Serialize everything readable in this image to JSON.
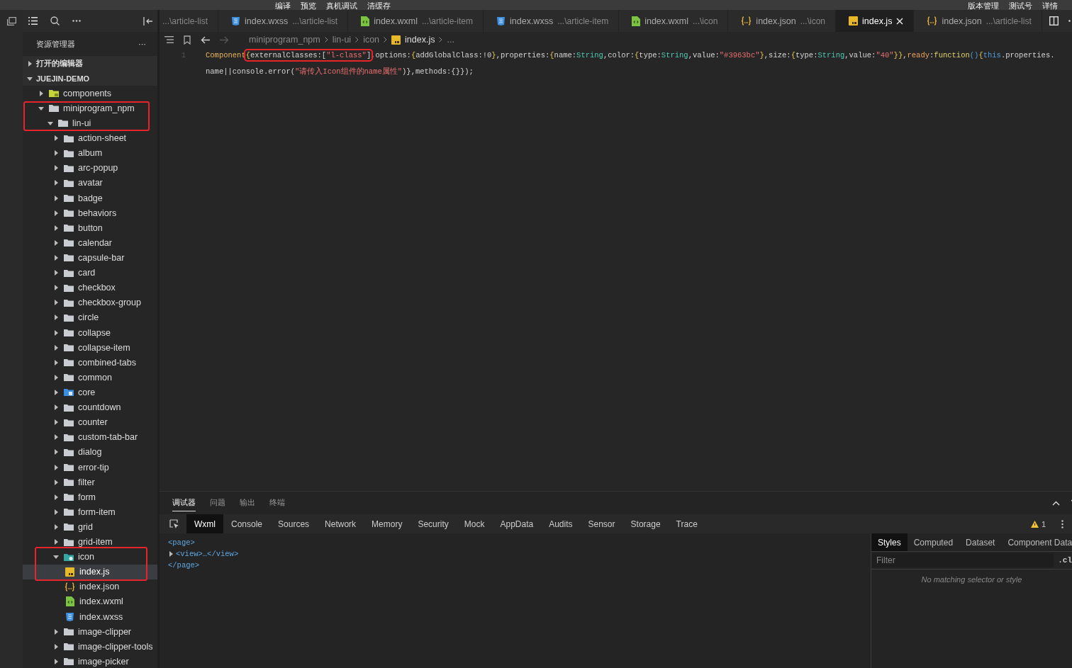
{
  "menubar": {
    "left": [
      "编译",
      "预览",
      "真机调试",
      "清缓存"
    ],
    "right": [
      "版本管理",
      "测试号",
      "详情"
    ]
  },
  "tabs": [
    {
      "path": "...\\article-list",
      "kind": "none",
      "selected": false
    },
    {
      "name": "index.wxss",
      "path": "...\\article-list",
      "kind": "wxss",
      "selected": false
    },
    {
      "name": "index.wxml",
      "path": "...\\article-item",
      "kind": "wxml",
      "selected": false
    },
    {
      "name": "index.wxss",
      "path": "...\\article-item",
      "kind": "wxss",
      "selected": false
    },
    {
      "name": "index.wxml",
      "path": "...\\icon",
      "kind": "wxml",
      "selected": false
    },
    {
      "name": "index.json",
      "path": "...\\icon",
      "kind": "json",
      "selected": false
    },
    {
      "name": "index.js",
      "kind": "js",
      "selected": true
    },
    {
      "name": "index.json",
      "path": "...\\article-list",
      "kind": "json",
      "selected": false
    }
  ],
  "explorer": {
    "title": "资源管理器",
    "more": "···",
    "sections": [
      {
        "label": "打开的编辑器",
        "expanded": false
      },
      {
        "label": "JUEJIN-DEMO",
        "expanded": true
      }
    ],
    "tree": [
      {
        "label": "components",
        "kind": "component-folder",
        "expanded": false,
        "selected": false
      },
      {
        "label": "miniprogram_npm",
        "kind": "folder",
        "expanded": true,
        "selected": false,
        "children": [
          {
            "label": "lin-ui",
            "kind": "folder",
            "expanded": true,
            "selected": false,
            "children": [
              {
                "label": "action-sheet",
                "kind": "folder",
                "expanded": false,
                "selected": false
              },
              {
                "label": "album",
                "kind": "folder",
                "expanded": false,
                "selected": false
              },
              {
                "label": "arc-popup",
                "kind": "folder",
                "expanded": false,
                "selected": false
              },
              {
                "label": "avatar",
                "kind": "folder",
                "expanded": false,
                "selected": false
              },
              {
                "label": "badge",
                "kind": "folder",
                "expanded": false,
                "selected": false
              },
              {
                "label": "behaviors",
                "kind": "folder",
                "expanded": false,
                "selected": false
              },
              {
                "label": "button",
                "kind": "folder",
                "expanded": false,
                "selected": false
              },
              {
                "label": "calendar",
                "kind": "folder",
                "expanded": false,
                "selected": false
              },
              {
                "label": "capsule-bar",
                "kind": "folder",
                "expanded": false,
                "selected": false
              },
              {
                "label": "card",
                "kind": "folder",
                "expanded": false,
                "selected": false
              },
              {
                "label": "checkbox",
                "kind": "folder",
                "expanded": false,
                "selected": false
              },
              {
                "label": "checkbox-group",
                "kind": "folder",
                "expanded": false,
                "selected": false
              },
              {
                "label": "circle",
                "kind": "folder",
                "expanded": false,
                "selected": false
              },
              {
                "label": "collapse",
                "kind": "folder",
                "expanded": false,
                "selected": false
              },
              {
                "label": "collapse-item",
                "kind": "folder",
                "expanded": false,
                "selected": false
              },
              {
                "label": "combined-tabs",
                "kind": "folder",
                "expanded": false,
                "selected": false
              },
              {
                "label": "common",
                "kind": "folder",
                "expanded": false,
                "selected": false
              },
              {
                "label": "core",
                "kind": "core-folder",
                "expanded": false,
                "selected": false
              },
              {
                "label": "countdown",
                "kind": "folder",
                "expanded": false,
                "selected": false
              },
              {
                "label": "counter",
                "kind": "folder",
                "expanded": false,
                "selected": false
              },
              {
                "label": "custom-tab-bar",
                "kind": "folder",
                "expanded": false,
                "selected": false
              },
              {
                "label": "dialog",
                "kind": "folder",
                "expanded": false,
                "selected": false
              },
              {
                "label": "error-tip",
                "kind": "folder",
                "expanded": false,
                "selected": false
              },
              {
                "label": "filter",
                "kind": "folder",
                "expanded": false,
                "selected": false
              },
              {
                "label": "form",
                "kind": "folder",
                "expanded": false,
                "selected": false
              },
              {
                "label": "form-item",
                "kind": "folder",
                "expanded": false,
                "selected": false
              },
              {
                "label": "grid",
                "kind": "folder",
                "expanded": false,
                "selected": false
              },
              {
                "label": "grid-item",
                "kind": "folder",
                "expanded": false,
                "selected": false
              },
              {
                "label": "icon",
                "kind": "icon-folder",
                "expanded": true,
                "selected": false,
                "children": [
                  {
                    "label": "index.js",
                    "kind": "js",
                    "selected": true
                  },
                  {
                    "label": "index.json",
                    "kind": "json",
                    "selected": false
                  },
                  {
                    "label": "index.wxml",
                    "kind": "wxml",
                    "selected": false
                  },
                  {
                    "label": "index.wxss",
                    "kind": "wxss",
                    "selected": false
                  }
                ]
              },
              {
                "label": "image-clipper",
                "kind": "folder",
                "expanded": false,
                "selected": false
              },
              {
                "label": "image-clipper-tools",
                "kind": "folder",
                "expanded": false,
                "selected": false
              },
              {
                "label": "image-picker",
                "kind": "folder",
                "expanded": false,
                "selected": false
              }
            ]
          }
        ]
      }
    ]
  },
  "breadcrumb": {
    "segments": [
      "miniprogram_npm",
      "lin-ui",
      "icon"
    ],
    "file": "index.js",
    "more": "..."
  },
  "code": {
    "line_number": "1",
    "lines": [
      [
        {
          "text": "Component",
          "kind": "class"
        },
        {
          "text": "{",
          "kind": "bracket",
          "annotated": true
        },
        {
          "text": "externalClasses:[",
          "kind": "plain",
          "annotated": true
        },
        {
          "text": "\"l-class\"",
          "kind": "string",
          "annotated": true
        },
        {
          "text": "]",
          "kind": "plain",
          "annotated": true
        },
        {
          "text": ",options:",
          "kind": "plain"
        },
        {
          "text": "{",
          "kind": "bracket"
        },
        {
          "text": "addGlobalClass:!0",
          "kind": "plain"
        },
        {
          "text": "}",
          "kind": "bracket"
        },
        {
          "text": ",properties:",
          "kind": "plain"
        },
        {
          "text": "{",
          "kind": "bracket"
        },
        {
          "text": "name:",
          "kind": "plain"
        },
        {
          "text": "String",
          "kind": "type"
        },
        {
          "text": ",color:",
          "kind": "plain"
        },
        {
          "text": "{",
          "kind": "bracket"
        },
        {
          "text": "type:",
          "kind": "plain"
        },
        {
          "text": "String",
          "kind": "type"
        },
        {
          "text": ",value:",
          "kind": "plain"
        },
        {
          "text": "\"#3963bc\"",
          "kind": "string"
        },
        {
          "text": "}",
          "kind": "bracket"
        },
        {
          "text": ",size:",
          "kind": "plain"
        },
        {
          "text": "{",
          "kind": "bracket"
        },
        {
          "text": "type:",
          "kind": "plain"
        },
        {
          "text": "String",
          "kind": "type"
        },
        {
          "text": ",value:",
          "kind": "plain"
        },
        {
          "text": "\"40\"",
          "kind": "string"
        },
        {
          "text": "}}",
          "kind": "bracket"
        },
        {
          "text": ",",
          "kind": "plain"
        },
        {
          "text": "ready",
          "kind": "keyword"
        },
        {
          "text": ":",
          "kind": "plain"
        },
        {
          "text": "function",
          "kind": "function"
        },
        {
          "text": "()",
          "kind": "paren"
        },
        {
          "text": "{",
          "kind": "bracket"
        },
        {
          "text": "this",
          "kind": "this"
        },
        {
          "text": ".properties.",
          "kind": "plain"
        }
      ],
      [
        {
          "text": "name||console.error(",
          "kind": "plain"
        },
        {
          "text": "\"请传入Icon组件的name属性\"",
          "kind": "string"
        },
        {
          "text": ")},methods:{}});",
          "kind": "plain"
        }
      ]
    ]
  },
  "annotations": [
    {
      "kind": "frame"
    },
    {
      "kind": "frame"
    }
  ],
  "devtools": {
    "panels": [
      {
        "label": "调试器",
        "selected": true
      },
      {
        "label": "问题",
        "selected": false
      },
      {
        "label": "输出",
        "selected": false
      },
      {
        "label": "终端",
        "selected": false
      }
    ],
    "tools": [
      {
        "label": "Wxml",
        "selected": true
      },
      {
        "label": "Console",
        "selected": false
      },
      {
        "label": "Sources",
        "selected": false
      },
      {
        "label": "Network",
        "selected": false
      },
      {
        "label": "Memory",
        "selected": false
      },
      {
        "label": "Security",
        "selected": false
      },
      {
        "label": "Mock",
        "selected": false
      },
      {
        "label": "AppData",
        "selected": false
      },
      {
        "label": "Audits",
        "selected": false
      },
      {
        "label": "Sensor",
        "selected": false
      },
      {
        "label": "Storage",
        "selected": false
      },
      {
        "label": "Trace",
        "selected": false
      }
    ],
    "warnings": "1",
    "dom": [
      {
        "text": "<page>",
        "kind": "open"
      },
      {
        "text": "<view>…</view>",
        "kind": "collapsed"
      },
      {
        "text": "</page>",
        "kind": "close"
      }
    ],
    "style_tabs": [
      {
        "label": "Styles",
        "selected": true
      },
      {
        "label": "Computed",
        "selected": false
      },
      {
        "label": "Dataset",
        "selected": false
      },
      {
        "label": "Component Data",
        "selected": false
      }
    ],
    "filter": {
      "placeholder": "Filter"
    },
    "class_toggle": ".cl",
    "empty_message": "No matching selector or style"
  }
}
